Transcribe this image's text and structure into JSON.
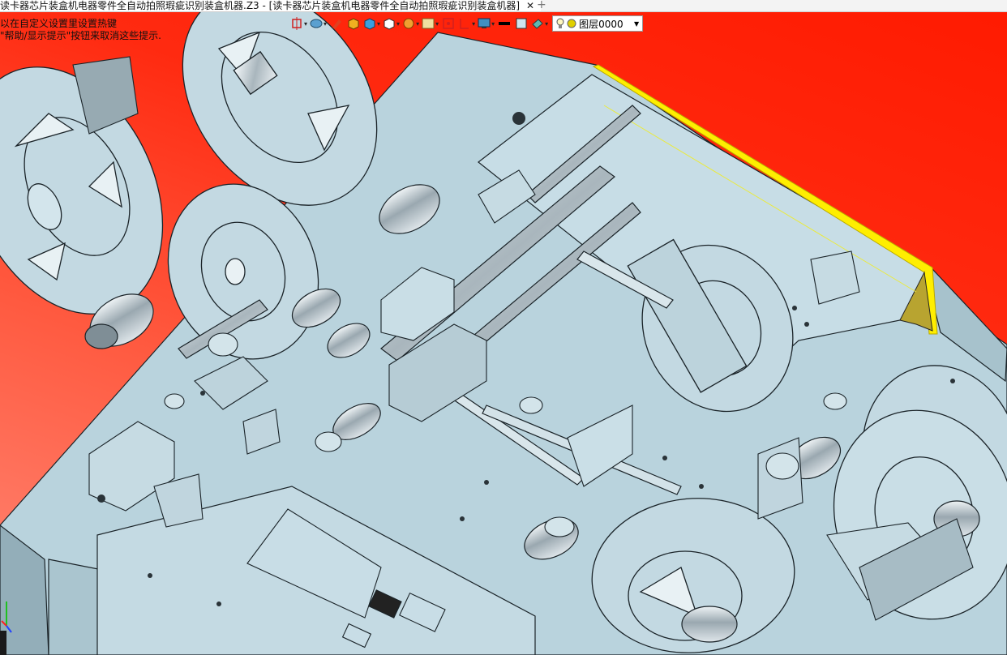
{
  "window": {
    "tab_title": "读卡器芯片装盒机电器零件全自动拍照瑕疵识别装盒机器.Z3 - [读卡器芯片装盒机电器零件全自动拍照瑕疵识别装盒机器]",
    "close_icon": "close-icon",
    "new_tab_icon": "plus-icon"
  },
  "hint": {
    "line1": "以在自定义设置里设置热键",
    "line2": "\"帮助/显示提示\"按钮来取消这些提示."
  },
  "toolbar": {
    "items": [
      {
        "name": "view-frame-icon",
        "has_dropdown": true
      },
      {
        "name": "render-mode-icon",
        "has_dropdown": true
      },
      {
        "name": "pencil-icon",
        "has_dropdown": false
      },
      {
        "name": "shaded-box-icon",
        "has_dropdown": false
      },
      {
        "name": "blue-box-icon",
        "has_dropdown": true
      },
      {
        "name": "white-box-icon",
        "has_dropdown": true
      },
      {
        "name": "ball-icon",
        "has_dropdown": true
      },
      {
        "name": "photo-icon",
        "has_dropdown": true
      },
      {
        "name": "snap-icon",
        "has_dropdown": false
      },
      {
        "name": "section-icon",
        "has_dropdown": true
      },
      {
        "name": "monitor-icon",
        "has_dropdown": true
      },
      {
        "name": "line-color-icon",
        "has_dropdown": false
      },
      {
        "name": "fill-color-icon",
        "has_dropdown": false
      },
      {
        "name": "paint-icon",
        "has_dropdown": true
      }
    ],
    "layer": {
      "icon": "lightbulb-icon",
      "dot_color": "#e0d000",
      "value": "图层0000"
    }
  },
  "colors": {
    "background_top": "#ff1a00",
    "background_bottom": "#ff8a78",
    "model_face": "#c7dde6",
    "highlight_edge": "#ffee00"
  },
  "axis_triad": {
    "x_color": "#ff2020",
    "y_color": "#20c020",
    "z_color": "#2040ff"
  }
}
